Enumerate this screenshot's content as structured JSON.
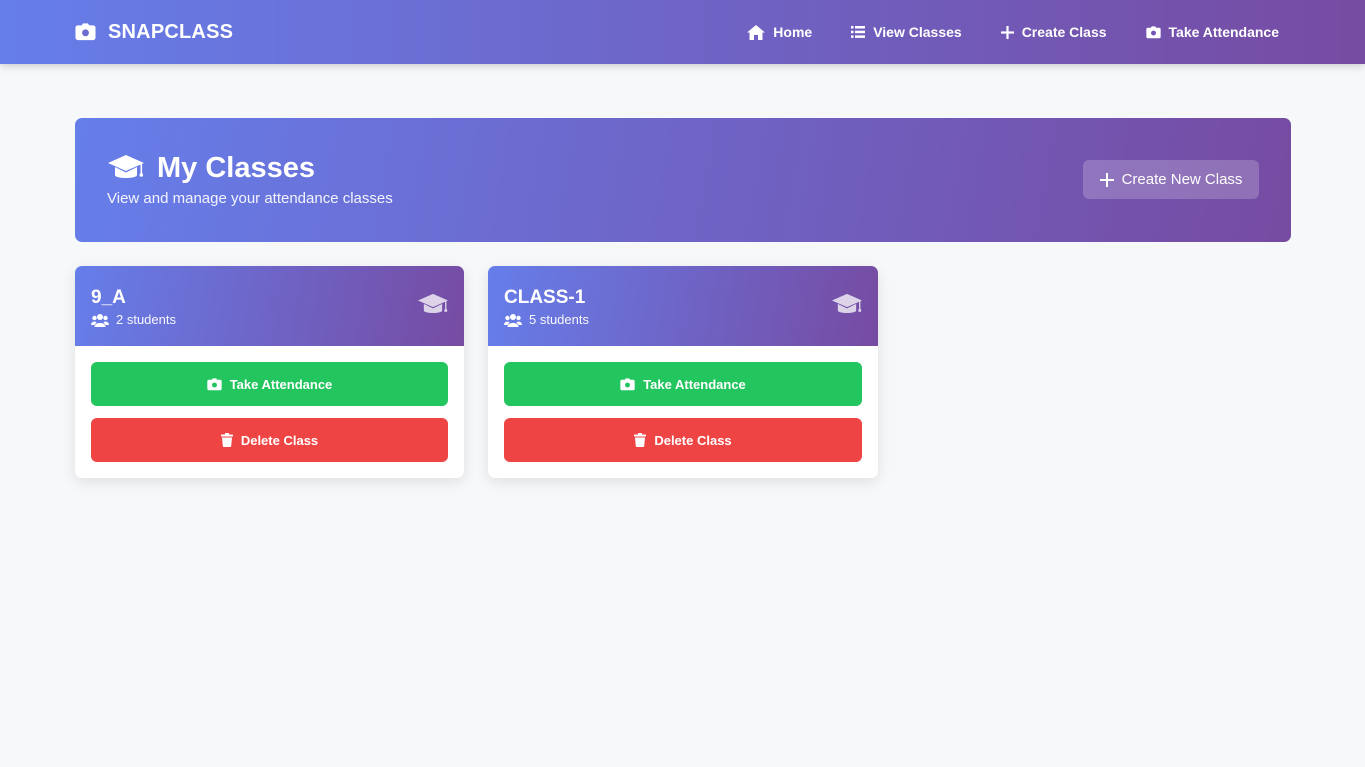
{
  "nav": {
    "brand": "SNAPCLASS",
    "links": [
      {
        "label": "Home",
        "icon": "home-icon"
      },
      {
        "label": "View Classes",
        "icon": "list-icon"
      },
      {
        "label": "Create Class",
        "icon": "plus-icon"
      },
      {
        "label": "Take Attendance",
        "icon": "camera-icon"
      }
    ]
  },
  "hero": {
    "title": "My Classes",
    "subtitle": "View and manage your attendance classes",
    "create_button": "Create New Class"
  },
  "classes": [
    {
      "name": "9_A",
      "students": "2 students",
      "take_label": "Take Attendance",
      "delete_label": "Delete Class"
    },
    {
      "name": "CLASS-1",
      "students": "5 students",
      "take_label": "Take Attendance",
      "delete_label": "Delete Class"
    }
  ],
  "colors": {
    "gradient_start": "#667eea",
    "gradient_end": "#764ba2",
    "take_button": "#22c55e",
    "delete_button": "#ef4444",
    "background": "#f7f8fa"
  }
}
